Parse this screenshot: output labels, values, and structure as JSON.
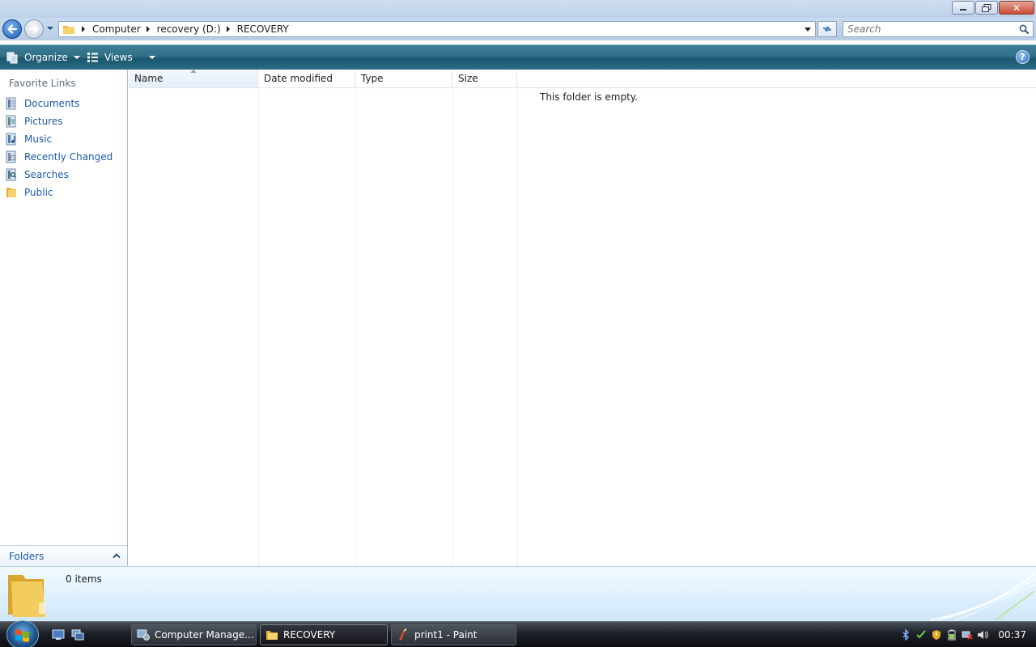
{
  "window": {
    "buttons": {
      "minimize_icon": "minimize-icon",
      "maximize_icon": "restore-icon",
      "close_icon": "close-icon"
    }
  },
  "address": {
    "breadcrumbs": [
      {
        "label": "Computer"
      },
      {
        "label": "recovery (D:)"
      },
      {
        "label": "RECOVERY"
      }
    ]
  },
  "search": {
    "placeholder": "Search"
  },
  "toolbar": {
    "organize_label": "Organize",
    "views_label": "Views",
    "help_label": "?"
  },
  "nav": {
    "header": "Favorite Links",
    "links": [
      {
        "label": "Documents",
        "icon": "documents-icon"
      },
      {
        "label": "Pictures",
        "icon": "pictures-icon"
      },
      {
        "label": "Music",
        "icon": "music-icon"
      },
      {
        "label": "Recently Changed",
        "icon": "recently-changed-icon"
      },
      {
        "label": "Searches",
        "icon": "searches-icon"
      },
      {
        "label": "Public",
        "icon": "public-folder-icon"
      }
    ],
    "folders_label": "Folders"
  },
  "filelist": {
    "columns": [
      "Name",
      "Date modified",
      "Type",
      "Size"
    ],
    "sorted_column": "Name",
    "empty_message": "This folder is empty."
  },
  "details": {
    "count": "0 items"
  },
  "taskbar": {
    "tasks": [
      {
        "label": "Computer Manage...",
        "icon": "computer-management-icon",
        "active": false
      },
      {
        "label": "RECOVERY",
        "icon": "folder-icon",
        "active": true
      },
      {
        "label": "print1 - Paint",
        "icon": "paint-icon",
        "active": false
      }
    ],
    "clock": "00:37"
  },
  "colors": {
    "link": "#1e5ba8",
    "toolbar": "#2f6f88",
    "taskbar": "#1d2027"
  }
}
